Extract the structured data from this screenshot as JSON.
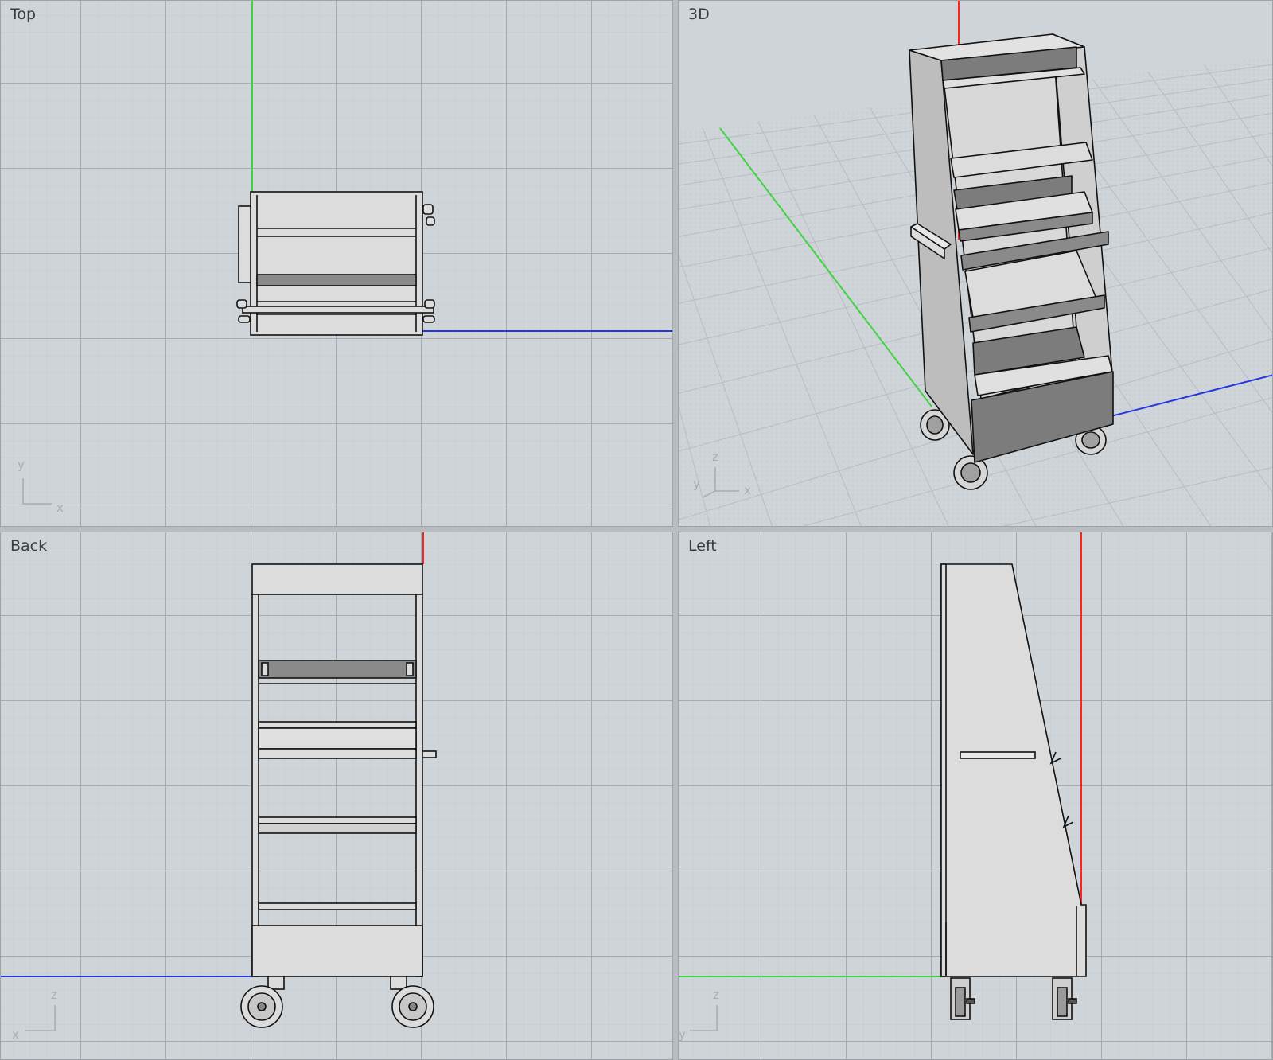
{
  "viewports": {
    "top": {
      "label": "Top",
      "axes": [
        "y",
        "x"
      ]
    },
    "perspective": {
      "label": "3D",
      "axes": [
        "z",
        "y",
        "x"
      ]
    },
    "back": {
      "label": "Back",
      "axes": [
        "z",
        "x"
      ]
    },
    "left": {
      "label": "Left",
      "axes": [
        "z",
        "y"
      ]
    }
  },
  "colors": {
    "viewport_bg": "#cfd4d9",
    "grid_minor": "#b9bec4",
    "grid_major": "#a9aeb4",
    "x_axis": "#ff2020",
    "y_axis": "#3fd33f",
    "z_axis": "#2438e0",
    "model_fill": "#dcdcdc",
    "model_dark": "#7c7c7c",
    "model_edge": "#111111"
  }
}
